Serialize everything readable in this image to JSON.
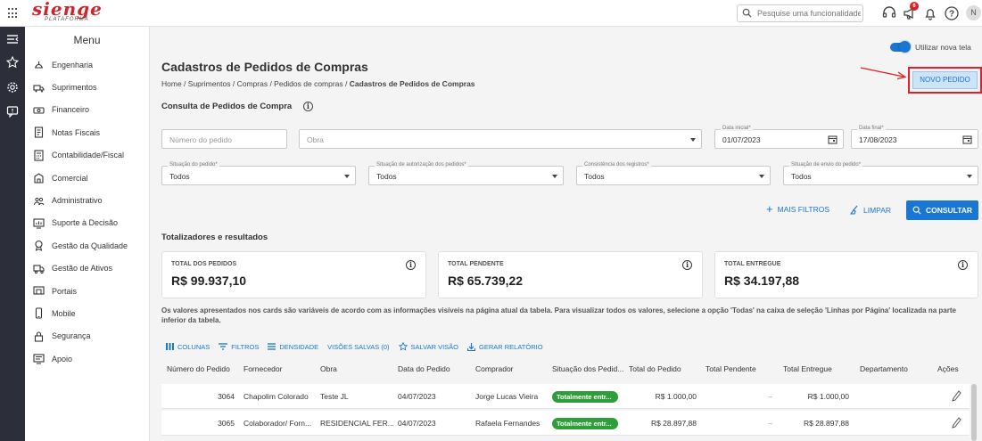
{
  "app": {
    "brand": "sienge",
    "brand_sub": "PLATAFORMA"
  },
  "topbar": {
    "search_placeholder": "Pesquise uma funcionalidade",
    "notification_count": "6",
    "avatar_initial": "N"
  },
  "menu": {
    "title": "Menu",
    "items": [
      {
        "label": "Engenharia",
        "icon": "helmet-icon"
      },
      {
        "label": "Suprimentos",
        "icon": "truck-icon"
      },
      {
        "label": "Financeiro",
        "icon": "money-icon"
      },
      {
        "label": "Notas Fiscais",
        "icon": "invoice-icon"
      },
      {
        "label": "Contabilidade/Fiscal",
        "icon": "calculator-icon"
      },
      {
        "label": "Comercial",
        "icon": "building-icon"
      },
      {
        "label": "Administrativo",
        "icon": "people-icon"
      },
      {
        "label": "Suporte à Decisão",
        "icon": "chart-icon"
      },
      {
        "label": "Gestão da Qualidade",
        "icon": "medal-icon"
      },
      {
        "label": "Gestão de Ativos",
        "icon": "vehicle-icon"
      },
      {
        "label": "Portais",
        "icon": "portal-icon"
      },
      {
        "label": "Mobile",
        "icon": "mobile-icon"
      },
      {
        "label": "Segurança",
        "icon": "lock-icon"
      },
      {
        "label": "Apoio",
        "icon": "support-icon"
      }
    ]
  },
  "page": {
    "toggle_label": "Utilizar nova tela",
    "title": "Cadastros de Pedidos de Compras",
    "breadcrumb": [
      "Home",
      "Suprimentos",
      "Compras",
      "Pedidos de compras",
      "Cadastros de Pedidos de Compras"
    ],
    "new_button": "NOVO PEDIDO",
    "consulta_title": "Consulta de Pedidos de Compra"
  },
  "filters": {
    "numero_placeholder": "Número do pedido",
    "obra_placeholder": "Obra",
    "data_inicial_label": "Data inicial*",
    "data_inicial": "01/07/2023",
    "data_final_label": "Data final*",
    "data_final": "17/08/2023",
    "situacao_label": "Situação do pedido*",
    "situacao_value": "Todos",
    "autorizacao_label": "Situação de autorização dos pedidos*",
    "autorizacao_value": "Todos",
    "consistencia_label": "Consistência dos registros*",
    "consistencia_value": "Todos",
    "envio_label": "Situação de envio do pedido*",
    "envio_value": "Todos",
    "mais_filtros": "MAIS FILTROS",
    "limpar": "LIMPAR",
    "consultar": "CONSULTAR"
  },
  "totals": {
    "title": "Totalizadores e resultados",
    "cards": [
      {
        "label": "TOTAL DOS PEDIDOS",
        "value": "R$ 99.937,10"
      },
      {
        "label": "TOTAL PENDENTE",
        "value": "R$ 65.739,22"
      },
      {
        "label": "TOTAL ENTREGUE",
        "value": "R$ 34.197,88"
      }
    ],
    "note": "Os valores apresentados nos cards são variáveis de acordo com as informações visíveis na página atual da tabela. Para visualizar todos os valores, selecione a opção 'Todas' na caixa de seleção 'Linhas por Página' localizada na parte inferior da tabela."
  },
  "table_toolbar": {
    "colunas": "COLUNAS",
    "filtros": "FILTROS",
    "densidade": "DENSIDADE",
    "visoes": "VISÕES SALVAS (0)",
    "salvar": "SALVAR VISÃO",
    "relatorio": "GERAR RELATÓRIO"
  },
  "table": {
    "headers": [
      "Número do Pedido",
      "Fornecedor",
      "Obra",
      "Data do Pedido",
      "Comprador",
      "Situação dos Pedid...",
      "Total do Pedido",
      "Total Pendente",
      "Total Entregue",
      "Departamento",
      "Ações"
    ],
    "rows": [
      {
        "numero": "3064",
        "fornecedor": "Chapolim Colorado",
        "obra": "Teste JL",
        "data": "04/07/2023",
        "comprador": "Jorge Lucas Vieira",
        "situacao": "Totalmente entr...",
        "total": "R$ 1.000,00",
        "pendente": "–",
        "entregue": "R$ 1.000,00",
        "departamento": ""
      },
      {
        "numero": "3065",
        "fornecedor": "Colaborador/ Forn...",
        "obra": "RESIDENCIAL FER...",
        "data": "04/07/2023",
        "comprador": "Rafaela Fernandes",
        "situacao": "Totalmente entr...",
        "total": "R$ 28.897,88",
        "pendente": "–",
        "entregue": "R$ 28.897,88",
        "departamento": ""
      }
    ]
  }
}
